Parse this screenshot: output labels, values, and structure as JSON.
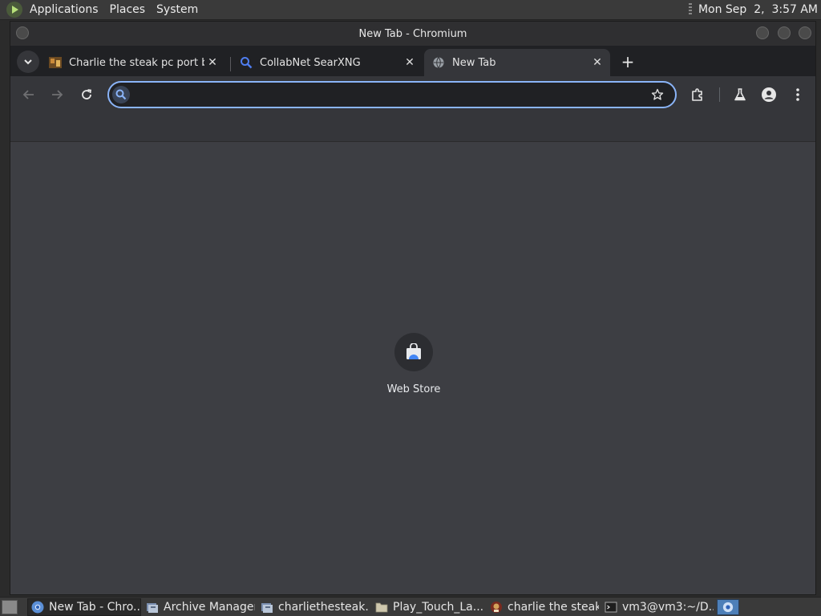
{
  "top_panel": {
    "menus": [
      "Applications",
      "Places",
      "System"
    ],
    "clock": "Mon Sep  2,  3:57 AM"
  },
  "window": {
    "title": "New Tab - Chromium"
  },
  "tabs": [
    {
      "title": "Charlie the steak pc port by L",
      "favicon": "game-thumbnail-icon",
      "active": false
    },
    {
      "title": "CollabNet SearXNG",
      "favicon": "search-icon",
      "active": false
    },
    {
      "title": "New Tab",
      "favicon": "globe-icon",
      "active": true
    }
  ],
  "omnibox": {
    "value": "",
    "placeholder": ""
  },
  "colors": {
    "accent": "#8ab4f8",
    "tab_strip": "#202124",
    "toolbar": "#35363a",
    "content": "#3d3e43"
  },
  "shortcut": {
    "label": "Web Store",
    "icon": "web-store-icon"
  },
  "taskbar": {
    "tasks": [
      {
        "label": "New Tab - Chro...",
        "icon": "chromium-icon",
        "active": true
      },
      {
        "label": "Archive Manager",
        "icon": "archive-manager-icon",
        "active": false
      },
      {
        "label": "charliethesteak....",
        "icon": "archive-file-icon",
        "active": false
      },
      {
        "label": "Play_Touch_La...",
        "icon": "folder-icon",
        "active": false
      },
      {
        "label": "charlie the steak",
        "icon": "game-icon",
        "active": false
      },
      {
        "label": "vm3@vm3:~/D...",
        "icon": "terminal-icon",
        "active": false
      }
    ]
  }
}
